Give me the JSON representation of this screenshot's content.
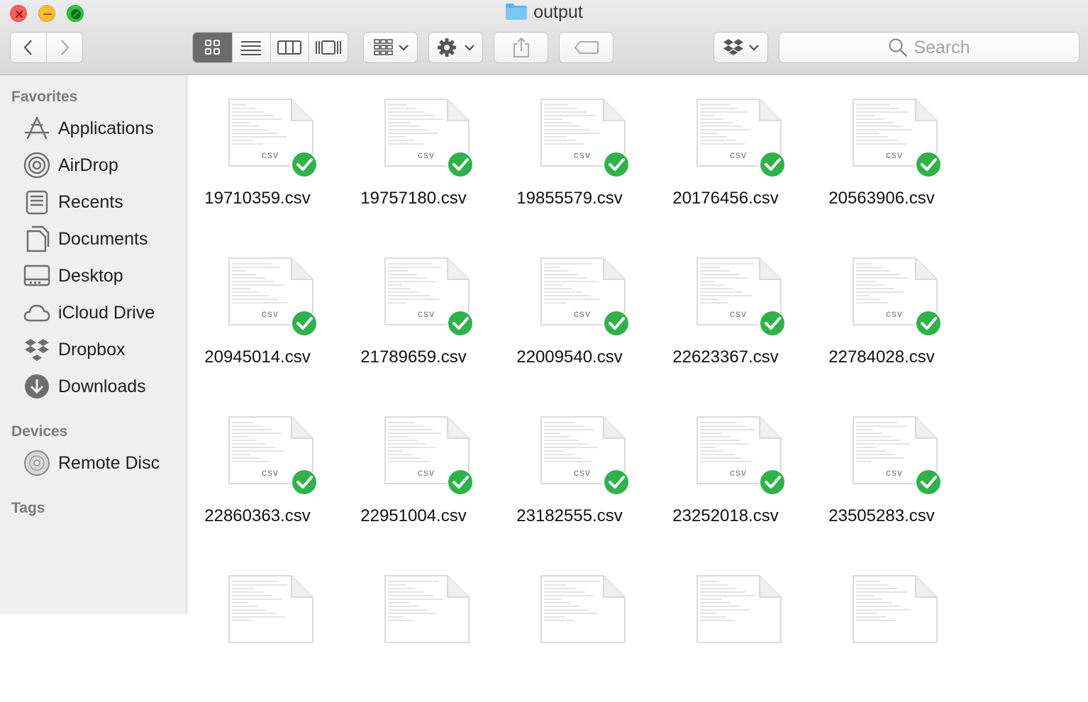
{
  "window": {
    "title": "output"
  },
  "toolbar": {
    "back_label": "Back",
    "forward_label": "Forward",
    "search_placeholder": "Search"
  },
  "sidebar": {
    "favorites_header": "Favorites",
    "favorites": [
      {
        "label": "Applications",
        "icon": "applications-icon"
      },
      {
        "label": "AirDrop",
        "icon": "airdrop-icon"
      },
      {
        "label": "Recents",
        "icon": "recents-icon"
      },
      {
        "label": "Documents",
        "icon": "documents-icon"
      },
      {
        "label": "Desktop",
        "icon": "desktop-icon"
      },
      {
        "label": "iCloud Drive",
        "icon": "icloud-icon"
      },
      {
        "label": "Dropbox",
        "icon": "dropbox-icon"
      },
      {
        "label": "Downloads",
        "icon": "downloads-icon"
      }
    ],
    "devices_header": "Devices",
    "devices": [
      {
        "label": "Remote Disc",
        "icon": "disc-icon"
      }
    ],
    "tags_header": "Tags"
  },
  "files": [
    {
      "name": "19710359.csv",
      "type": "CSV",
      "synced": true
    },
    {
      "name": "19757180.csv",
      "type": "CSV",
      "synced": true
    },
    {
      "name": "19855579.csv",
      "type": "CSV",
      "synced": true
    },
    {
      "name": "20176456.csv",
      "type": "CSV",
      "synced": true
    },
    {
      "name": "20563906.csv",
      "type": "CSV",
      "synced": true
    },
    {
      "name": "20945014.csv",
      "type": "CSV",
      "synced": true
    },
    {
      "name": "21789659.csv",
      "type": "CSV",
      "synced": true
    },
    {
      "name": "22009540.csv",
      "type": "CSV",
      "synced": true
    },
    {
      "name": "22623367.csv",
      "type": "CSV",
      "synced": true
    },
    {
      "name": "22784028.csv",
      "type": "CSV",
      "synced": true
    },
    {
      "name": "22860363.csv",
      "type": "CSV",
      "synced": true
    },
    {
      "name": "22951004.csv",
      "type": "CSV",
      "synced": true
    },
    {
      "name": "23182555.csv",
      "type": "CSV",
      "synced": true
    },
    {
      "name": "23252018.csv",
      "type": "CSV",
      "synced": true
    },
    {
      "name": "23505283.csv",
      "type": "CSV",
      "synced": true
    },
    {
      "name": "",
      "type": "",
      "synced": false
    },
    {
      "name": "",
      "type": "",
      "synced": false
    },
    {
      "name": "",
      "type": "",
      "synced": false
    },
    {
      "name": "",
      "type": "",
      "synced": false
    },
    {
      "name": "",
      "type": "",
      "synced": false
    }
  ],
  "colors": {
    "sync_check": "#2fb24a",
    "sidebar_bg": "#efefef",
    "accent_folder": "#5fb3f0"
  }
}
